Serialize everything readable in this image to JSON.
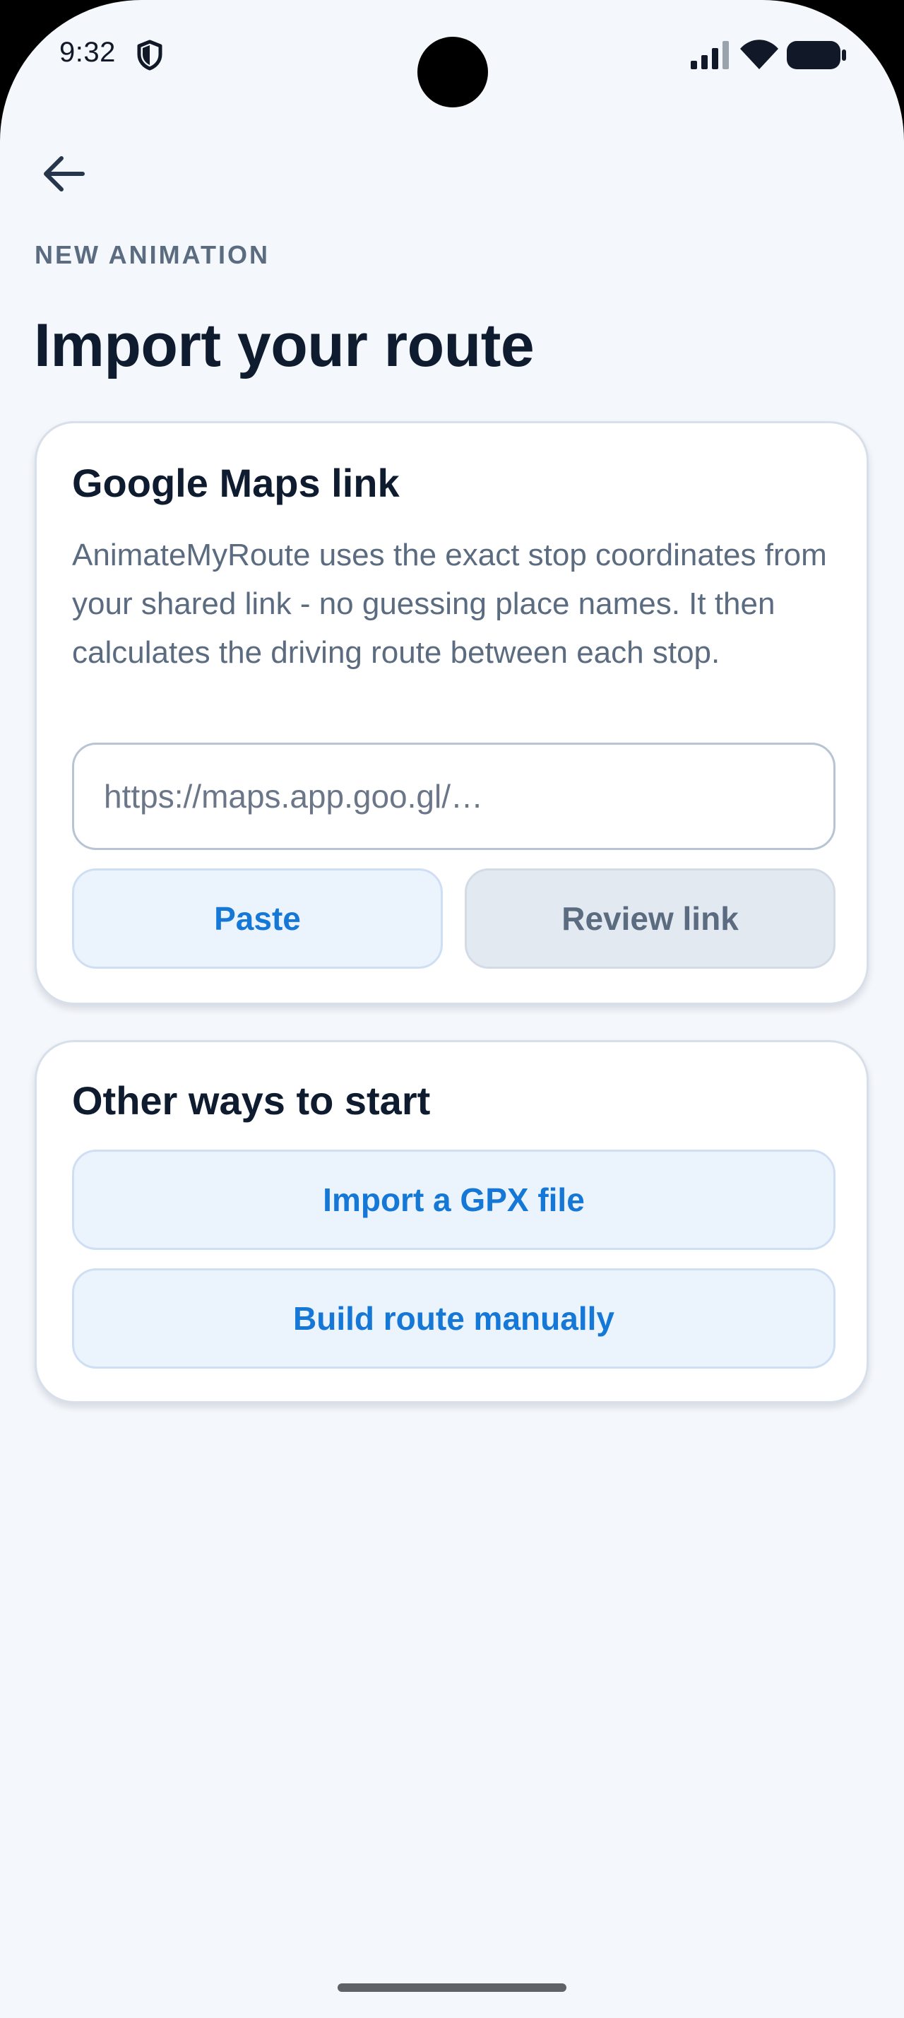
{
  "status_bar": {
    "time": "9:32",
    "icons": [
      "shield-icon",
      "signal-icon",
      "wifi-icon",
      "battery-icon"
    ]
  },
  "header": {
    "back_icon": "arrow-left-icon",
    "eyebrow": "NEW ANIMATION",
    "title": "Import your route"
  },
  "maps_card": {
    "title": "Google Maps link",
    "description": "AnimateMyRoute uses the exact stop coordinates from your shared link - no guessing place names. It then calculates the driving route between each stop.",
    "input_value": "",
    "input_placeholder": "https://maps.app.goo.gl/…",
    "paste_label": "Paste",
    "review_label": "Review link"
  },
  "other_card": {
    "title": "Other ways to start",
    "gpx_label": "Import a GPX file",
    "manual_label": "Build route manually"
  },
  "colors": {
    "background": "#f4f7fb",
    "card": "#ffffff",
    "title": "#0f1b2e",
    "muted": "#5b6b80",
    "accent": "#1578d6",
    "accent_soft_bg": "#ebf3fd",
    "disabled_bg": "#e3e9f1"
  }
}
